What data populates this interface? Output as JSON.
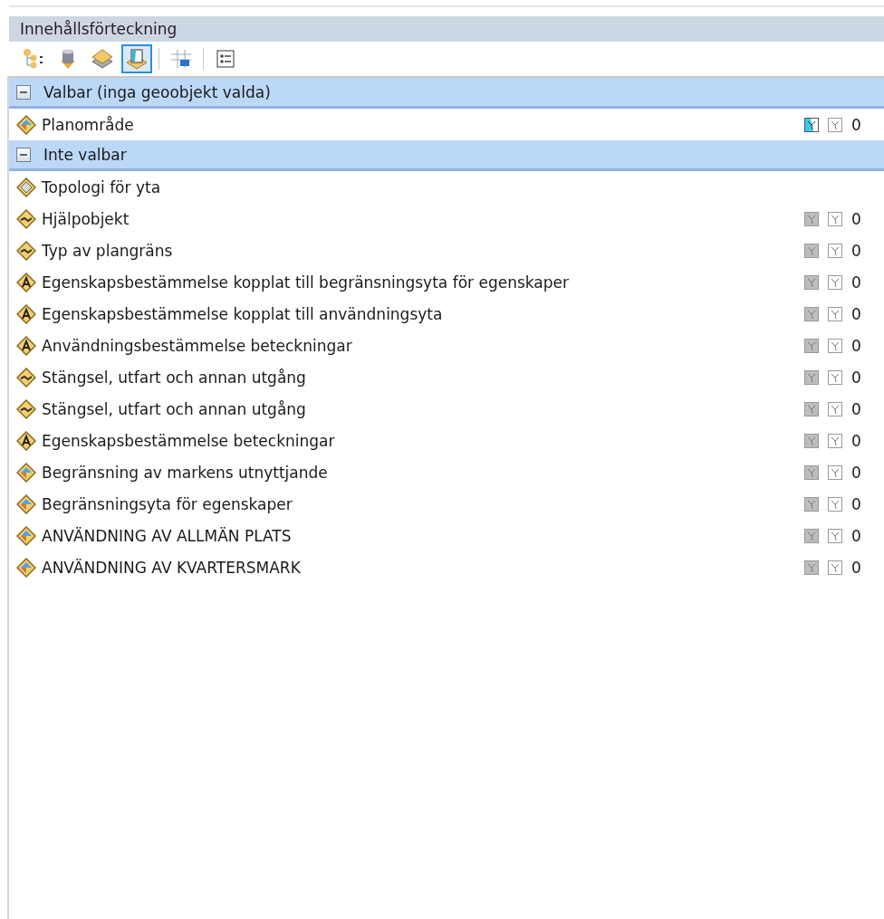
{
  "panel": {
    "title": "Innehållsförteckning"
  },
  "toolbar": [
    {
      "kind": "drawing-order",
      "selected": false
    },
    {
      "kind": "source",
      "selected": false
    },
    {
      "kind": "visibility",
      "selected": false
    },
    {
      "kind": "selection",
      "selected": true
    },
    {
      "kind": "separator"
    },
    {
      "kind": "snapping",
      "selected": false
    },
    {
      "kind": "separator"
    },
    {
      "kind": "options",
      "selected": false
    }
  ],
  "groups": [
    {
      "label": "Valbar (inga geoobjekt valda)",
      "expanded": true,
      "layers": [
        {
          "name": "Planområde",
          "kind": "polygon",
          "selectable": true,
          "show_selected": false,
          "count": "0"
        }
      ]
    },
    {
      "label": "Inte valbar",
      "expanded": true,
      "layers": [
        {
          "name": "Topologi för yta",
          "kind": "topology"
        },
        {
          "name": "Hjälpobjekt",
          "kind": "line",
          "selectable": false,
          "show_selected": false,
          "count": "0"
        },
        {
          "name": "Typ av plangräns",
          "kind": "line",
          "selectable": false,
          "show_selected": false,
          "count": "0"
        },
        {
          "name": "Egenskapsbestämmelse kopplat till begränsningsyta för egenskaper",
          "kind": "annotation",
          "selectable": false,
          "show_selected": false,
          "count": "0"
        },
        {
          "name": "Egenskapsbestämmelse kopplat till användningsyta",
          "kind": "annotation",
          "selectable": false,
          "show_selected": false,
          "count": "0"
        },
        {
          "name": "Användningsbestämmelse beteckningar",
          "kind": "annotation",
          "selectable": false,
          "show_selected": false,
          "count": "0"
        },
        {
          "name": "Stängsel, utfart och annan utgång",
          "kind": "line",
          "selectable": false,
          "show_selected": false,
          "count": "0"
        },
        {
          "name": "Stängsel, utfart och annan utgång",
          "kind": "line",
          "selectable": false,
          "show_selected": false,
          "count": "0"
        },
        {
          "name": "Egenskapsbestämmelse beteckningar",
          "kind": "annotation",
          "selectable": false,
          "show_selected": false,
          "count": "0"
        },
        {
          "name": "Begränsning av markens utnyttjande",
          "kind": "polygon",
          "selectable": false,
          "show_selected": false,
          "count": "0"
        },
        {
          "name": "Begränsningsyta för egenskaper",
          "kind": "polygon",
          "selectable": false,
          "show_selected": false,
          "count": "0"
        },
        {
          "name": "ANVÄNDNING AV ALLMÄN PLATS",
          "kind": "polygon",
          "selectable": false,
          "show_selected": false,
          "count": "0"
        },
        {
          "name": "ANVÄNDNING AV KVARTERSMARK",
          "kind": "polygon",
          "selectable": false,
          "show_selected": false,
          "count": "0"
        }
      ]
    }
  ]
}
